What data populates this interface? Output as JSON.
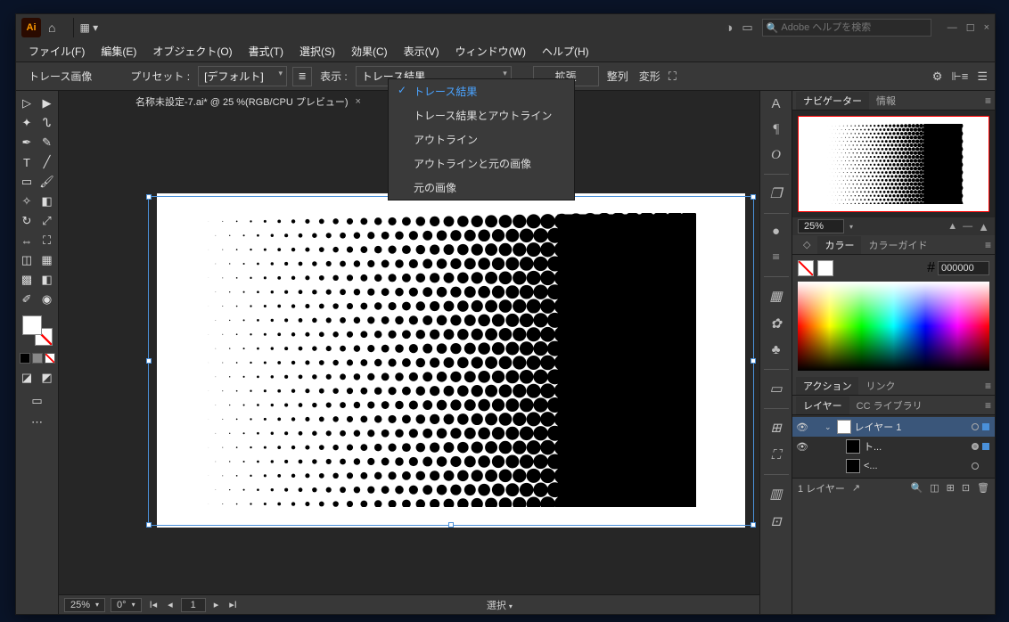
{
  "title_bar": {
    "logo": "Ai",
    "search_placeholder": "Adobe ヘルプを検索",
    "win": {
      "min": "—",
      "max": "☐",
      "close": "×"
    }
  },
  "layout_dropdown_icon": "▦ ▾",
  "menu": [
    "ファイル(F)",
    "編集(E)",
    "オブジェクト(O)",
    "書式(T)",
    "選択(S)",
    "効果(C)",
    "表示(V)",
    "ウィンドウ(W)",
    "ヘルプ(H)"
  ],
  "control": {
    "trace_image": "トレース画像",
    "preset_label": "プリセット :",
    "preset_value": "[デフォルト]",
    "view_label": "表示 :",
    "view_value": "トレース結果",
    "expand": "拡張",
    "align": "整列",
    "transform": "変形"
  },
  "popup": {
    "items": [
      "トレース結果",
      "トレース結果とアウトライン",
      "アウトライン",
      "アウトラインと元の画像",
      "元の画像"
    ],
    "selected_index": 0
  },
  "doc_tab": {
    "name": "名称未設定-7.ai* @ 25 %(RGB/CPU プレビュー)",
    "close": "×"
  },
  "right_strip": [
    "A",
    "¶",
    "O",
    "❐",
    "●",
    "≡",
    "▦",
    "✿",
    "♣",
    "▭",
    "⊞",
    "⛶",
    "▥",
    "⊡"
  ],
  "panels": {
    "navigator": {
      "tabs": [
        "ナビゲーター",
        "情報"
      ],
      "active": 0,
      "zoom": "25%"
    },
    "color": {
      "tabs": [
        "カラー",
        "カラーガイド"
      ],
      "active": 0,
      "hex_label": "#",
      "hex": "000000"
    },
    "actions": {
      "tabs": [
        "アクション",
        "リンク"
      ],
      "active": 0
    },
    "layers": {
      "tabs": [
        "レイヤー",
        "CC ライブラリ"
      ],
      "active": 0,
      "rows": [
        {
          "name": "レイヤー 1",
          "expanded": true,
          "sel": true
        },
        {
          "name": "ト...",
          "sel": false
        },
        {
          "name": "<...",
          "sel": false
        }
      ],
      "footer": "1 レイヤー"
    }
  },
  "status": {
    "zoom": "25%",
    "rotate": "0°",
    "page": "1",
    "mode": "選択"
  }
}
